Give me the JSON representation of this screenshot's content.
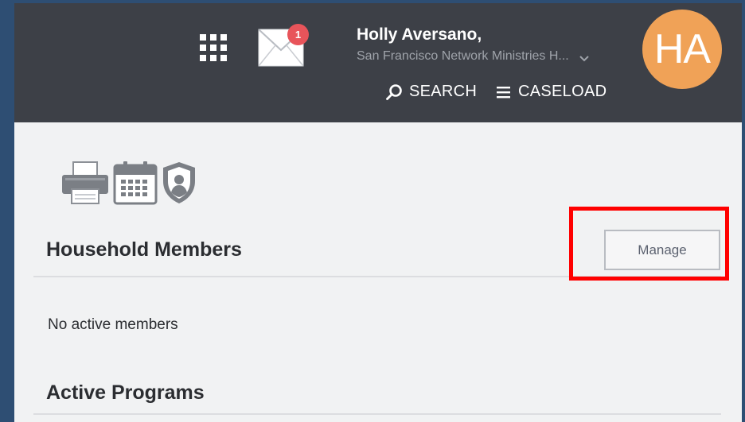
{
  "header": {
    "user_name": "Holly Aversano,",
    "organization": "San Francisco Network Ministries H...",
    "avatar_initials": "HA",
    "mail_badge_count": "1",
    "nav": {
      "search_label": "SEARCH",
      "caseload_label": "CASELOAD"
    }
  },
  "toolbar": {
    "icons": [
      "printer-icon",
      "calendar-icon",
      "shield-user-icon"
    ]
  },
  "household": {
    "title": "Household Members",
    "manage_label": "Manage",
    "empty_text": "No active members"
  },
  "programs": {
    "title": "Active Programs"
  },
  "colors": {
    "header_bg": "#3d4047",
    "avatar_bg": "#f0a257",
    "badge_bg": "#e8545a",
    "highlight": "#ff0000",
    "page_bg": "#f1f2f3"
  }
}
